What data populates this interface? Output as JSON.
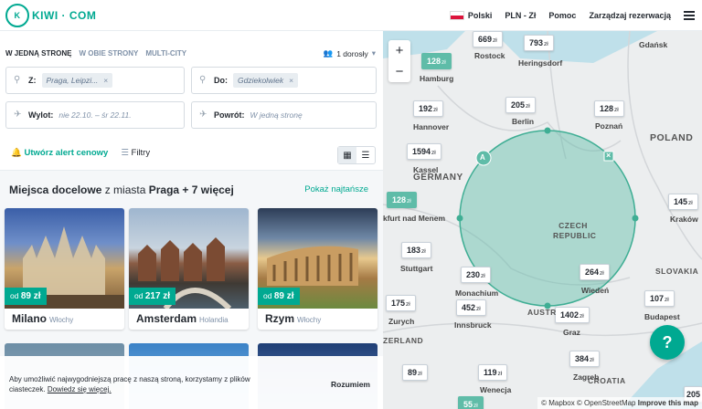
{
  "header": {
    "logo": "KIWI · COM",
    "language": "Polski",
    "currency": "PLN - Zł",
    "help": "Pomoc",
    "manage": "Zarządzaj rezerwacją"
  },
  "search": {
    "tabs": [
      "W JEDNĄ STRONĘ",
      "W OBIE STRONY",
      "MULTI-CITY"
    ],
    "passengers": "1 dorosły",
    "from_label": "Z:",
    "from_value": "Praga, Leipzi...",
    "to_label": "Do:",
    "to_value": "Gdziekolwiek",
    "depart_label": "Wylot:",
    "depart_placeholder": "nie 22.10. – śr 22.11.",
    "return_label": "Powrót:",
    "return_placeholder": "W jedną stronę",
    "alert": "Utwórz alert cenowy",
    "filters": "Filtry"
  },
  "destinations": {
    "title_bold": "Miejsca docelowe",
    "title_mid": "z miasta",
    "title_city": "Praga + 7 więcej",
    "show_cheapest": "Pokaż najtańsze",
    "cards": [
      {
        "price_prefix": "od",
        "price": "89 zł",
        "city": "Milano",
        "country": "Włochy"
      },
      {
        "price_prefix": "od",
        "price": "217 zł",
        "city": "Amsterdam",
        "country": "Holandia"
      },
      {
        "price_prefix": "od",
        "price": "89 zł",
        "city": "Rzym",
        "country": "Włochy"
      }
    ]
  },
  "cookie": {
    "text": "Aby umożliwić najwygodniejszą pracę z naszą stroną, korzystamy z plików ciasteczek.",
    "link": "Dowiedz się więcej.",
    "button": "Rozumiem"
  },
  "map": {
    "pins": [
      {
        "price": "669",
        "unit": "zł"
      },
      {
        "price": "793",
        "unit": "zł"
      },
      {
        "price": "128",
        "unit": "zł"
      },
      {
        "price": "205",
        "unit": "zł"
      },
      {
        "price": "192",
        "unit": "zł"
      },
      {
        "price": "128",
        "unit": "zł"
      },
      {
        "price": "1594",
        "unit": "zł"
      },
      {
        "price": "128",
        "unit": "zł"
      },
      {
        "price": "145",
        "unit": "zł"
      },
      {
        "price": "183",
        "unit": "zł"
      },
      {
        "price": "230",
        "unit": "zł"
      },
      {
        "price": "264",
        "unit": "zł"
      },
      {
        "price": "175",
        "unit": "zł"
      },
      {
        "price": "452",
        "unit": "zł"
      },
      {
        "price": "1402",
        "unit": "zł"
      },
      {
        "price": "107",
        "unit": "zł"
      },
      {
        "price": "384",
        "unit": "zł"
      },
      {
        "price": "89",
        "unit": "zł"
      },
      {
        "price": "119",
        "unit": "zł"
      },
      {
        "price": "55",
        "unit": "zł"
      }
    ],
    "cities": [
      "Rostock",
      "Gdańsk",
      "Hamburg",
      "Heringsdorf",
      "Berlin",
      "Poznań",
      "Hannover",
      "Kassel",
      "kfurt nad Menem",
      "Kraków",
      "Stuttgart",
      "Monachium",
      "Wiedeń",
      "Zurych",
      "Innsbruck",
      "Budapest",
      "Graz",
      "Zagreb",
      "Wenecja"
    ],
    "countries": [
      "POLAND",
      "GERMANY",
      "CZECH REPUBLIC",
      "SLOVAKIA",
      "AUSTR",
      "ZERLAND",
      "CROATIA"
    ],
    "circle_label": "A",
    "help_label": "?",
    "zoom_in": "+",
    "zoom_out": "−",
    "attribution": "© Mapbox © OpenStreetMap",
    "improve": "Improve this map",
    "edge_price": "205"
  }
}
